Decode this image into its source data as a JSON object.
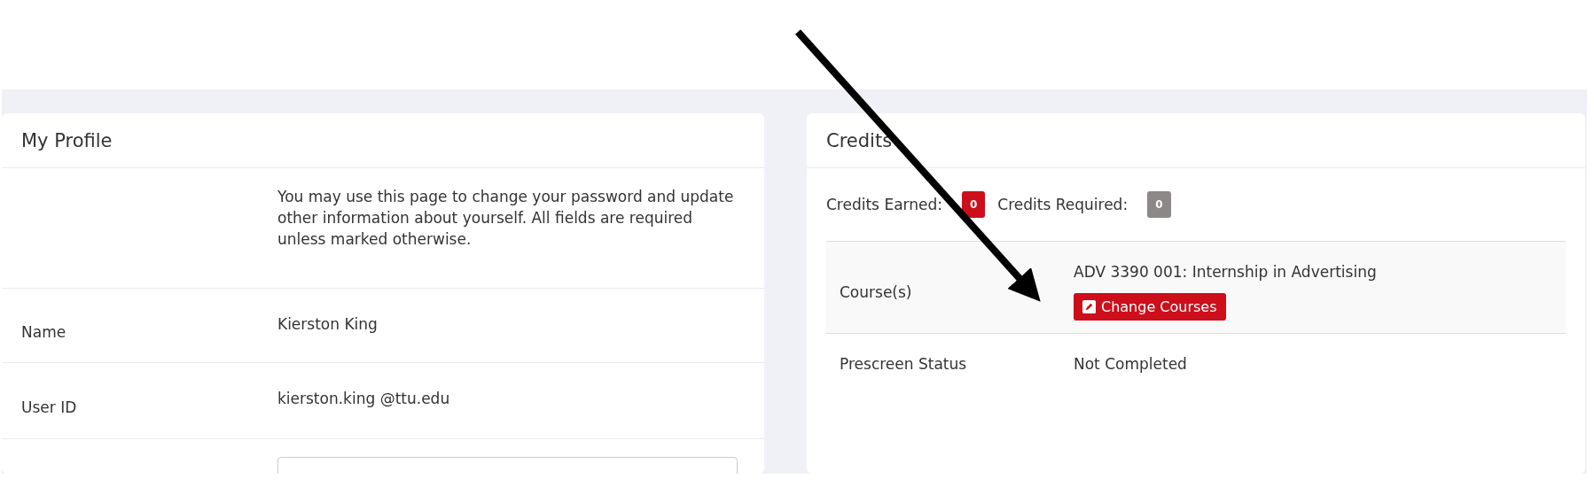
{
  "profile": {
    "title": "My Profile",
    "intro": "You may use this page to change your password and update other information about yourself. All fields are required unless marked otherwise.",
    "rows": [
      {
        "kind": "text",
        "label": "Name",
        "value": "Kierston King"
      },
      {
        "kind": "text",
        "label": "User ID",
        "value": "kierston.king @ttu.edu"
      },
      {
        "kind": "input"
      }
    ]
  },
  "credits": {
    "title": "Credits",
    "badges": [
      {
        "label": "Credits Earned:",
        "value": "0",
        "color": "#cc0f1b"
      },
      {
        "label": "Credits Required:",
        "value": "0",
        "color": "#8c8888"
      }
    ],
    "table": [
      {
        "label": "Course(s)",
        "value": "ADV 3390 001: Internship in Advertising",
        "button": "Change Courses",
        "selected": true
      },
      {
        "label": "Prescreen Status",
        "value": "Not Completed",
        "selected": false
      }
    ]
  }
}
